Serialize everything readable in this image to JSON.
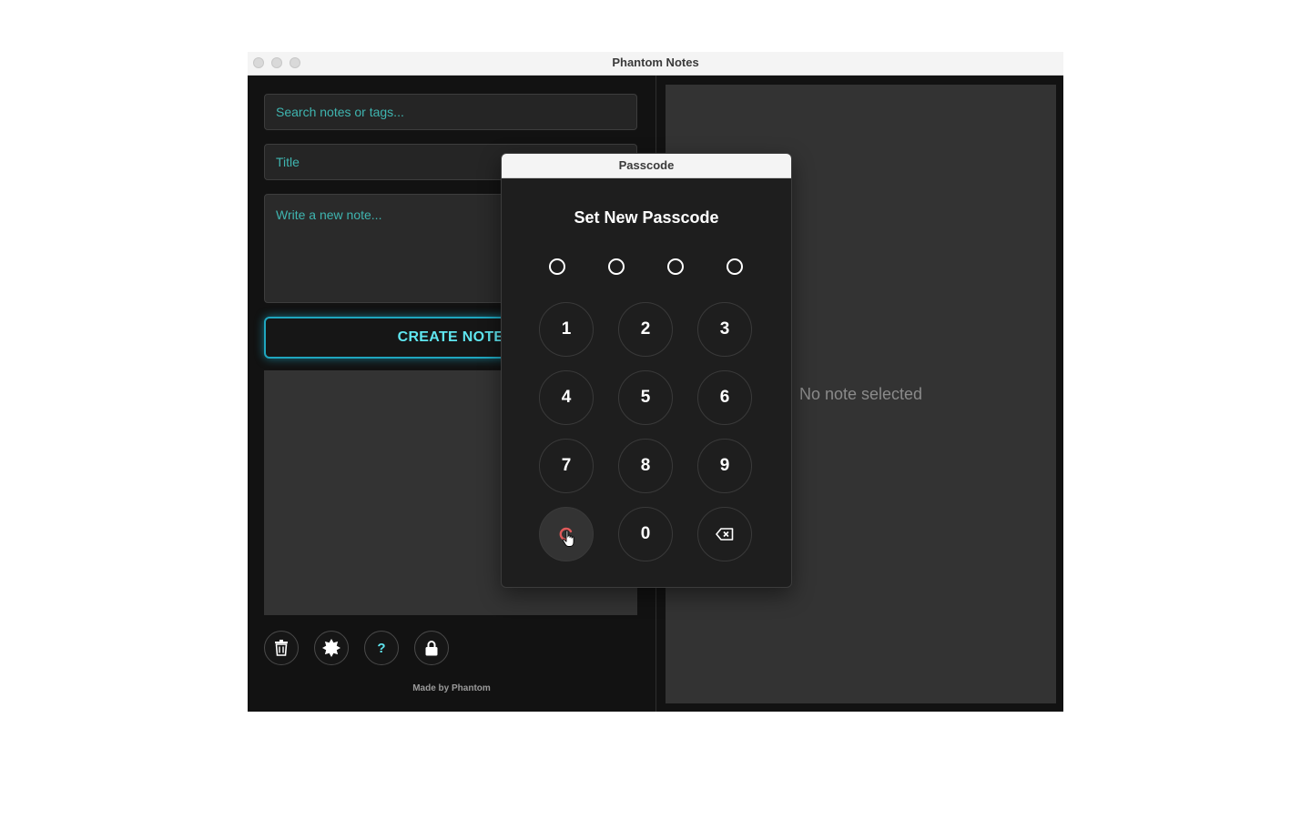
{
  "window": {
    "title": "Phantom Notes"
  },
  "sidebar": {
    "search_placeholder": "Search notes or tags...",
    "title_placeholder": "Title",
    "note_placeholder": "Write a new note...",
    "create_label": "CREATE NOTE",
    "tools": [
      {
        "icon": "trash-icon"
      },
      {
        "icon": "settings-badge-icon"
      },
      {
        "icon": "help-icon",
        "label": "?"
      },
      {
        "icon": "lock-icon"
      }
    ],
    "footer": "Made by Phantom"
  },
  "detail": {
    "empty_text": "No note selected"
  },
  "passcode_dialog": {
    "title": "Passcode",
    "heading": "Set New Passcode",
    "digits_entered": 0,
    "digits_total": 4,
    "keys": [
      "1",
      "2",
      "3",
      "4",
      "5",
      "6",
      "7",
      "8",
      "9",
      "0"
    ],
    "special_keys": {
      "left": "clear-icon",
      "right": "backspace-icon"
    }
  },
  "colors": {
    "accent": "#5fe6f0",
    "placeholder": "#3fb5b0",
    "background": "#121212",
    "panel": "#333333",
    "clear_icon": "#e05a5a"
  }
}
